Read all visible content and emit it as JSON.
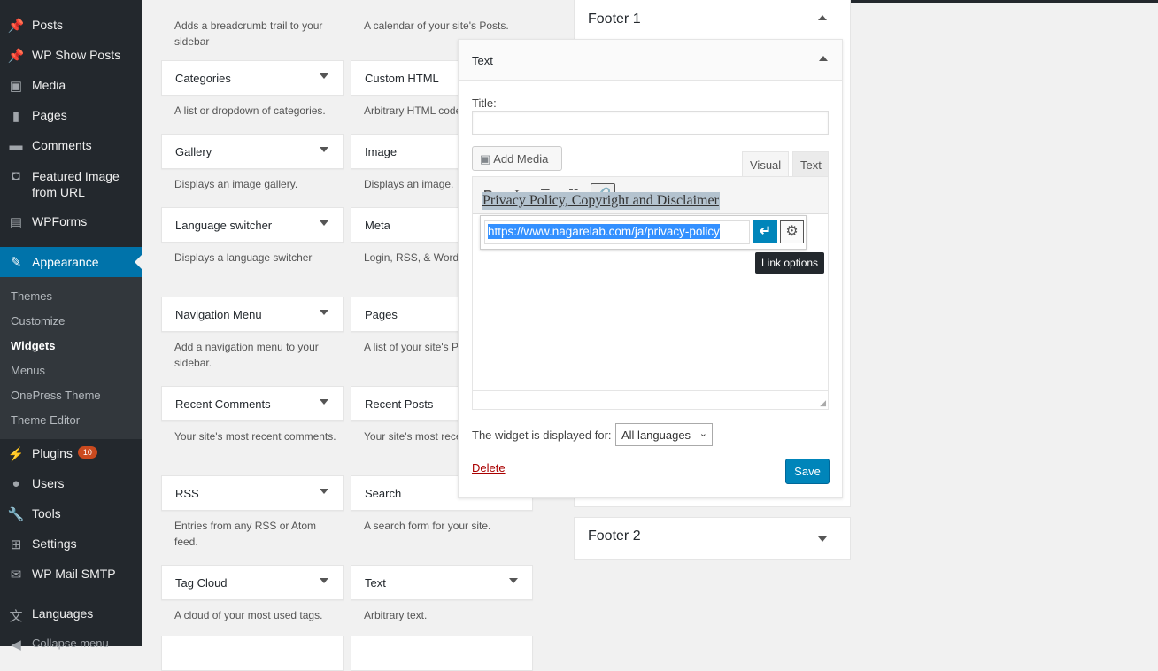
{
  "sidebar": {
    "items": [
      {
        "label": "Posts",
        "icon": "pin-icon"
      },
      {
        "label": "WP Show Posts",
        "icon": "pin-icon"
      },
      {
        "label": "Media",
        "icon": "media-icon"
      },
      {
        "label": "Pages",
        "icon": "pages-icon"
      },
      {
        "label": "Comments",
        "icon": "comment-icon"
      },
      {
        "label": "Featured Image from URL",
        "icon": "camera-icon"
      },
      {
        "label": "WPForms",
        "icon": "form-icon"
      },
      {
        "label": "Appearance",
        "icon": "brush-icon"
      },
      {
        "label": "Plugins",
        "icon": "plug-icon",
        "badge": "10"
      },
      {
        "label": "Users",
        "icon": "user-icon"
      },
      {
        "label": "Tools",
        "icon": "wrench-icon"
      },
      {
        "label": "Settings",
        "icon": "settings-icon"
      },
      {
        "label": "WP Mail SMTP",
        "icon": "mail-icon"
      },
      {
        "label": "Languages",
        "icon": "translate-icon"
      },
      {
        "label": "Collapse menu",
        "icon": "collapse-icon"
      }
    ],
    "submenu": [
      "Themes",
      "Customize",
      "Widgets",
      "Menus",
      "OnePress Theme",
      "Theme Editor"
    ],
    "accent": "#0073aa"
  },
  "widgets": {
    "top_descs": [
      "Adds a breadcrumb trail to your sidebar",
      "A calendar of your site's Posts."
    ],
    "col1": [
      {
        "title": "Categories",
        "desc": "A list or dropdown of categories."
      },
      {
        "title": "Gallery",
        "desc": "Displays an image gallery."
      },
      {
        "title": "Language switcher",
        "desc": "Displays a language switcher"
      },
      {
        "title": "Navigation Menu",
        "desc": "Add a navigation menu to your sidebar."
      },
      {
        "title": "Recent Comments",
        "desc": "Your site's most recent comments."
      },
      {
        "title": "RSS",
        "desc": "Entries from any RSS or Atom feed."
      },
      {
        "title": "Tag Cloud",
        "desc": "A cloud of your most used tags."
      }
    ],
    "col2": [
      {
        "title": "Custom HTML",
        "desc": "Arbitrary HTML code."
      },
      {
        "title": "Image",
        "desc": "Displays an image."
      },
      {
        "title": "Meta",
        "desc": "Login, RSS, & WordPress.org links."
      },
      {
        "title": "Pages",
        "desc": "A list of your site's Pages."
      },
      {
        "title": "Recent Posts",
        "desc": "Your site's most recent Posts."
      },
      {
        "title": "Search",
        "desc": "A search form for your site."
      },
      {
        "title": "Text",
        "desc": "Arbitrary text."
      }
    ]
  },
  "areas": {
    "footer1": "Footer 1",
    "footer2": "Footer 2"
  },
  "text_widget": {
    "header": "Text",
    "title_label": "Title:",
    "title_value": "",
    "add_media": "Add Media",
    "tab_visual": "Visual",
    "tab_text": "Text",
    "content_link": "Privacy Policy, Copyright and Disclaimer",
    "url": "https://www.nagarelab.com/ja/privacy-policy",
    "tooltip": "Link options",
    "displayed_for_label": "The widget is displayed for:",
    "language_select": "All languages",
    "delete": "Delete",
    "save": "Save"
  }
}
